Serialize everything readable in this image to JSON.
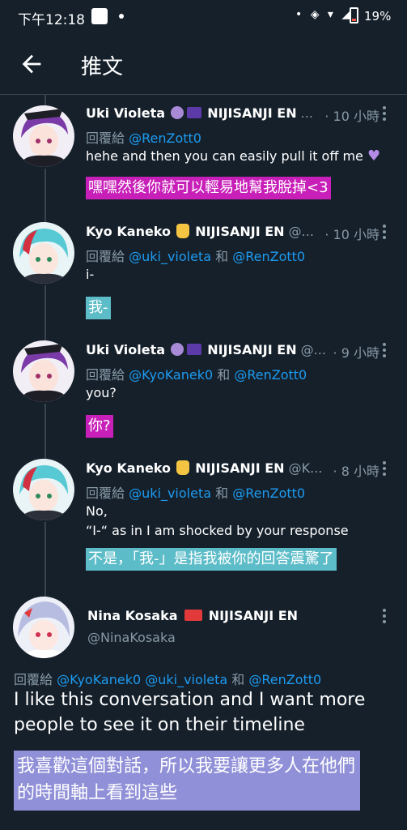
{
  "status_bar": {
    "time": "下午12:18",
    "dot": "•",
    "icons": "• ◈ ▾ ◢",
    "battery_percent": "19%",
    "battery_level": 0.19
  },
  "header": {
    "back_icon": "arrow-left-icon",
    "title": "推文"
  },
  "colors": {
    "background": "#15202b",
    "divider": "#38444d",
    "secondary_text": "#8899a6",
    "mention": "#1d9bf0",
    "highlight_magenta": "#c71fb8",
    "highlight_teal": "#5cbcc8",
    "highlight_periwinkle": "#9090d8"
  },
  "tweets": [
    {
      "name": "Uki Violeta",
      "badge": "NIJISANJI EN",
      "handle": "...",
      "time": "· 10 小時",
      "reply_prefix": "回覆給",
      "mentions": "@RenZott0",
      "mentions_and": "",
      "mentions_second": "",
      "text": "hehe and then you can easily pull it off me",
      "text_icon": "purple-heart-icon",
      "translation": "嘿嘿然後你就可以輕易地幫我脫掉<3",
      "translation_bg": "#c71fb8"
    },
    {
      "name": "Kyo Kaneko",
      "badge": "NIJISANJI EN",
      "handle": "@...",
      "time": "· 10 小時",
      "reply_prefix": "回覆給",
      "mentions": "@uki_violeta",
      "mentions_and": "和",
      "mentions_second": "@RenZott0",
      "text": "i-",
      "translation": "我-",
      "translation_bg": "#5cbcc8"
    },
    {
      "name": "Uki Violeta",
      "badge": "NIJISANJI EN",
      "handle": "@...",
      "time": "· 9 小時",
      "reply_prefix": "回覆給",
      "mentions": "@KyoKanek0",
      "mentions_and": "和",
      "mentions_second": "@RenZott0",
      "text": "you?",
      "translation": "你?",
      "translation_bg": "#c71fb8"
    },
    {
      "name": "Kyo Kaneko",
      "badge": "NIJISANJI EN",
      "handle": "@K...",
      "time": "· 8 小時",
      "reply_prefix": "回覆給",
      "mentions": "@uki_violeta",
      "mentions_and": "和",
      "mentions_second": "@RenZott0",
      "text_line1": "No,",
      "text_line2": "“I-“ as in I am shocked by your response",
      "translation": "不是，「我-」是指我被你的回答震驚了",
      "translation_bg": "#5cbcc8"
    }
  ],
  "main_tweet": {
    "name": "Nina Kosaka",
    "badge": "NIJISANJI EN",
    "handle": "@NinaKosaka",
    "reply_prefix": "回覆給",
    "mention1": "@KyoKanek0",
    "mention2": "@uki_violeta",
    "mentions_and": "和",
    "mention3": "@RenZott0",
    "text": "I like this conversation and I want more people to see it on their timeline",
    "translation": "我喜歡這個對話，所以我要讓更多人在他們的時間軸上看到這些",
    "translation_bg": "#9090d8"
  }
}
